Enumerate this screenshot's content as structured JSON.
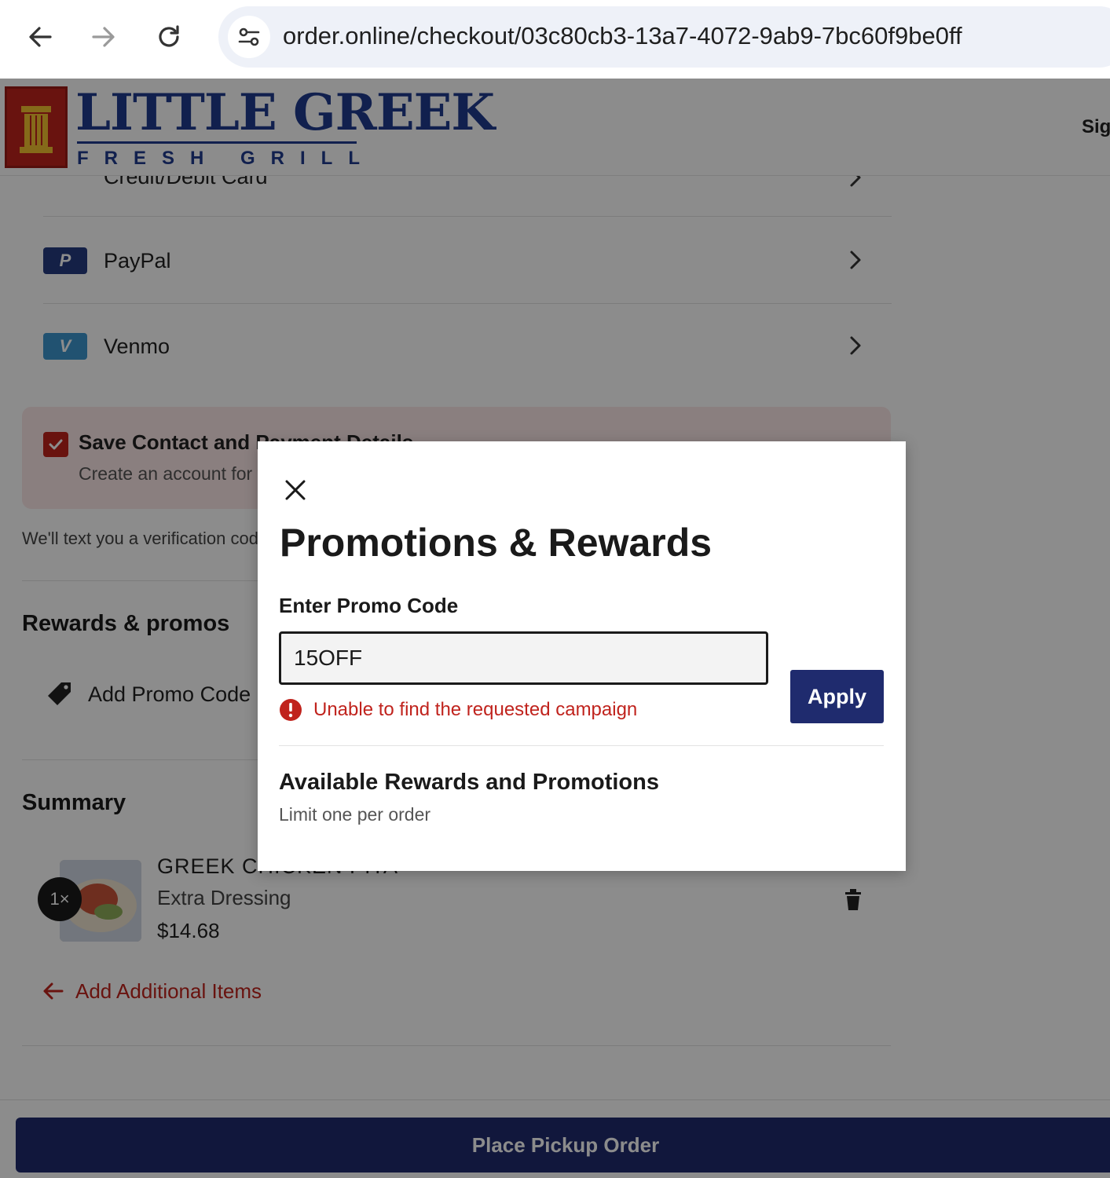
{
  "browser": {
    "url": "order.online/checkout/03c80cb3-13a7-4072-9ab9-7bc60f9be0ff",
    "icons": [
      "back-arrow-icon",
      "forward-arrow-icon",
      "reload-icon",
      "site-info-icon"
    ]
  },
  "header": {
    "logo_title": "LITTLE GREEK",
    "logo_subtitle": "FRESH GRILL",
    "signin_label": "Sig"
  },
  "payment": {
    "partial_label": "Credit/Debit Card",
    "methods": [
      {
        "label": "PayPal",
        "icon": "paypal-icon",
        "icon_text": "P",
        "color": "#253b80"
      },
      {
        "label": "Venmo",
        "icon": "venmo-icon",
        "icon_text": "V",
        "color": "#3d95ce"
      }
    ]
  },
  "save_details": {
    "checked": true,
    "title": "Save Contact and Payment Details",
    "subtitle": "Create an account for faster checkout",
    "verify_text": "We'll text you a verification code"
  },
  "rewards": {
    "section_title": "Rewards & promos",
    "add_promo_label": "Add Promo Code"
  },
  "summary": {
    "section_title": "Summary",
    "items": [
      {
        "qty": "1×",
        "name": "GREEK CHICKEN PITA",
        "option": "Extra Dressing",
        "price": "$14.68"
      }
    ],
    "add_items_label": "Add Additional Items"
  },
  "footer": {
    "place_order_label": "Place Pickup Order"
  },
  "modal": {
    "title": "Promotions & Rewards",
    "promo_label": "Enter Promo Code",
    "promo_value": "15OFF",
    "error_text": "Unable to find the requested campaign",
    "apply_label": "Apply",
    "available_title": "Available Rewards and Promotions",
    "available_subtitle": "Limit one per order"
  },
  "colors": {
    "brand_blue": "#1f3b8f",
    "brand_red": "#c0231d",
    "primary_button": "#1f2b6e",
    "error": "#c0231d"
  }
}
